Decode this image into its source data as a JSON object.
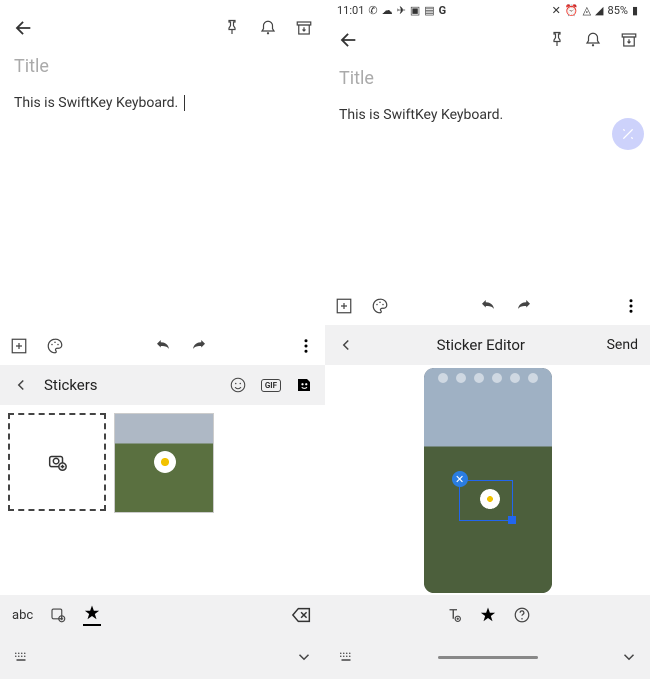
{
  "left": {
    "title_placeholder": "Title",
    "body": "This is SwiftKey Keyboard.",
    "stickers_label": "Stickers",
    "abc_label": "abc",
    "gif_label": "GIF"
  },
  "right": {
    "status_time": "11:01",
    "battery": "85%",
    "title_placeholder": "Title",
    "body": "This is SwiftKey Keyboard.",
    "editor_title": "Sticker Editor",
    "send_label": "Send"
  }
}
